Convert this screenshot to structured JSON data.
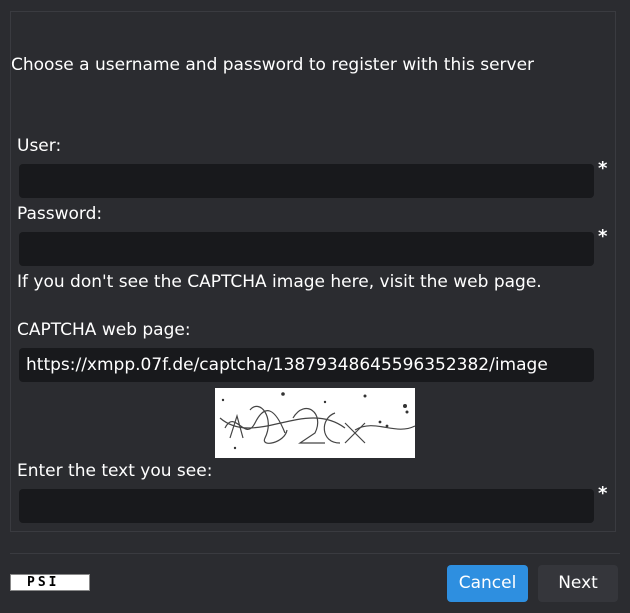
{
  "form": {
    "instructions": "Choose a username and password to register with this server",
    "user_label": "User:",
    "user_value": "",
    "password_label": "Password:",
    "password_value": "",
    "required_marker": "*",
    "captcha_hint": "If you don't see the CAPTCHA image here, visit the web page.",
    "captcha_page_label": "CAPTCHA web page:",
    "captcha_url": "https://xmpp.07f.de/captcha/13879348645596352382/image",
    "captcha_text_label": "Enter the text you see:",
    "captcha_text_value": ""
  },
  "footer": {
    "logo_text": "PSI",
    "cancel_label": "Cancel",
    "next_label": "Next"
  },
  "colors": {
    "background": "#2b2c30",
    "field": "#18191c",
    "accent": "#2e8fe0"
  }
}
